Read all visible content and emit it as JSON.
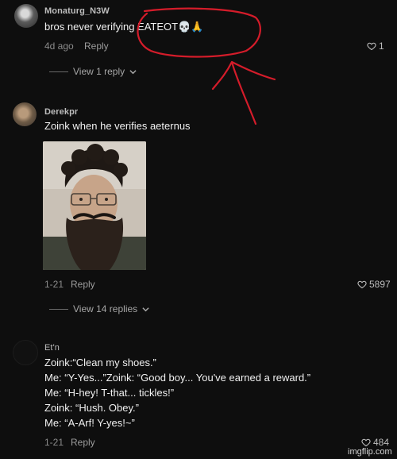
{
  "comments": [
    {
      "username": "Monaturg_N3W",
      "text": "bros never verifying EATEOT💀🙏",
      "time": "4d ago",
      "reply_label": "Reply",
      "likes": "1",
      "view_replies": "View 1 reply"
    },
    {
      "username": "Derekpr",
      "text": "Zoink when he verifies aeternus",
      "time": "1-21",
      "reply_label": "Reply",
      "likes": "5897",
      "view_replies": "View 14 replies"
    },
    {
      "username": "Et'n",
      "lines": [
        "Zoink:“Clean my shoes.”",
        "Me: “Y-Yes...”Zoink: “Good boy... You've earned a reward.”",
        "Me: “H-hey! T-that... tickles!”",
        "Zoink: “Hush. Obey.”",
        "Me: “A-Arf! Y-yes!~”"
      ],
      "time": "1-21",
      "reply_label": "Reply",
      "likes": "484"
    }
  ],
  "watermark": "imgflip.com",
  "colors": {
    "annotation": "#d41c2a",
    "background": "#0e0e0e"
  }
}
